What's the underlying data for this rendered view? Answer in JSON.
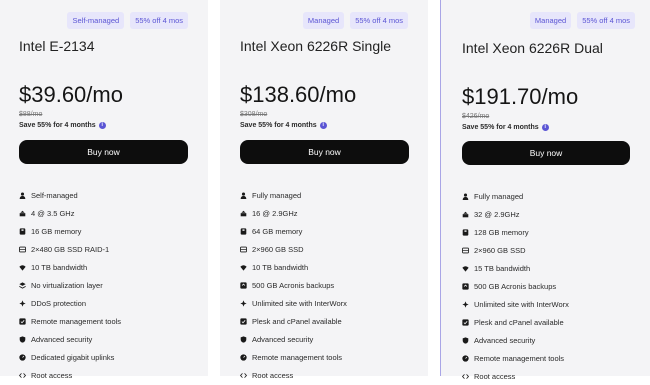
{
  "plans": [
    {
      "badges": [
        "Self-managed",
        "55% off 4 mos"
      ],
      "name": "Intel E-2134",
      "price": "$39.60/mo",
      "old_price": "$88/mo",
      "save_text": "Save 55% for 4 months",
      "button_label": "Buy now",
      "features": [
        {
          "icon": "user-icon",
          "label": "Self-managed"
        },
        {
          "icon": "cpu-icon",
          "label": "4 @ 3.5 GHz"
        },
        {
          "icon": "memory-icon",
          "label": "16 GB memory"
        },
        {
          "icon": "storage-icon",
          "label": "2×480 GB SSD RAID-1"
        },
        {
          "icon": "wifi-icon",
          "label": "10 TB bandwidth"
        },
        {
          "icon": "layers-icon",
          "label": "No virtualization layer"
        },
        {
          "icon": "shield-icon",
          "label": "DDoS protection"
        },
        {
          "icon": "check-icon",
          "label": "Remote management tools"
        },
        {
          "icon": "lock-icon",
          "label": "Advanced security"
        },
        {
          "icon": "gauge-icon",
          "label": "Dedicated gigabit uplinks"
        },
        {
          "icon": "code-icon",
          "label": "Root access"
        }
      ]
    },
    {
      "badges": [
        "Managed",
        "55% off 4 mos"
      ],
      "name": "Intel Xeon 6226R Single",
      "price": "$138.60/mo",
      "old_price": "$308/mo",
      "save_text": "Save 55% for 4 months",
      "button_label": "Buy now",
      "features": [
        {
          "icon": "user-icon",
          "label": "Fully managed"
        },
        {
          "icon": "cpu-icon",
          "label": "16 @ 2.9GHz"
        },
        {
          "icon": "memory-icon",
          "label": "64 GB memory"
        },
        {
          "icon": "storage-icon",
          "label": "2×960 GB SSD"
        },
        {
          "icon": "wifi-icon",
          "label": "10 TB bandwidth"
        },
        {
          "icon": "backup-icon",
          "label": "500 GB Acronis backups"
        },
        {
          "icon": "shield-icon",
          "label": "Unlimited site with InterWorx"
        },
        {
          "icon": "check-icon",
          "label": "Plesk and cPanel available"
        },
        {
          "icon": "lock-icon",
          "label": "Advanced security"
        },
        {
          "icon": "gauge-icon",
          "label": "Remote management tools"
        },
        {
          "icon": "code-icon",
          "label": "Root access"
        }
      ]
    },
    {
      "badges": [
        "Managed",
        "55% off 4 mos"
      ],
      "name": "Intel Xeon 6226R Dual",
      "price": "$191.70/mo",
      "old_price": "$426/mo",
      "save_text": "Save 55% for 4 months",
      "button_label": "Buy now",
      "features": [
        {
          "icon": "user-icon",
          "label": "Fully managed"
        },
        {
          "icon": "cpu-icon",
          "label": "32 @ 2.9GHz"
        },
        {
          "icon": "memory-icon",
          "label": "128 GB memory"
        },
        {
          "icon": "storage-icon",
          "label": "2×960 GB SSD"
        },
        {
          "icon": "wifi-icon",
          "label": "15 TB bandwidth"
        },
        {
          "icon": "backup-icon",
          "label": "500 GB Acronis backups"
        },
        {
          "icon": "shield-icon",
          "label": "Unlimited site with InterWorx"
        },
        {
          "icon": "check-icon",
          "label": "Plesk and cPanel available"
        },
        {
          "icon": "lock-icon",
          "label": "Advanced security"
        },
        {
          "icon": "gauge-icon",
          "label": "Remote management tools"
        },
        {
          "icon": "code-icon",
          "label": "Root access"
        }
      ]
    }
  ],
  "colors": {
    "accent": "#5b55d4",
    "badge_bg": "#e7e6fb",
    "button_bg": "#0d0d0d",
    "card_bg": "#f4f4f6"
  }
}
